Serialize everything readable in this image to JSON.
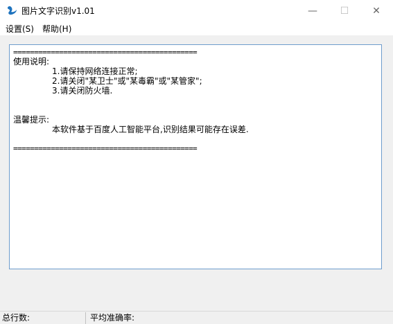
{
  "window": {
    "title": "图片文字识别v1.01",
    "minimize_glyph": "—",
    "maximize_glyph": "☐",
    "close_glyph": "✕",
    "icon": "app-swan-icon"
  },
  "menu": {
    "settings": "设置(S)",
    "help": "帮助(H)"
  },
  "textarea": {
    "separator_top": "============================================",
    "usage_title": "使用说明:",
    "usage_1": "1.请保持网络连接正常;",
    "usage_2": "2.请关闭\"某卫士\"或\"某毒霸\"或\"某管家\";",
    "usage_3": "3.请关闭防火墙.",
    "tip_title": "温馨提示:",
    "tip_1": "本软件基于百度人工智能平台,识别结果可能存在误差.",
    "separator_bottom": "============================================"
  },
  "status": {
    "total_lines": "总行数:",
    "avg_accuracy": "平均准确率:"
  },
  "colors": {
    "accent": "#1e73be",
    "border": "#6d9ccc"
  }
}
